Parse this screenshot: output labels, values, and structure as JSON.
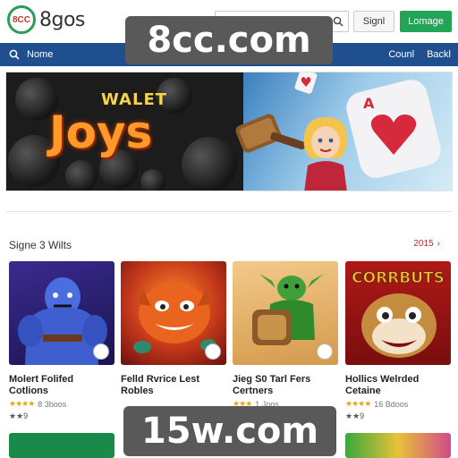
{
  "header": {
    "logo_badge": "8CC",
    "logo_text": "8gos",
    "search_placeholder": "",
    "login_label": "Signl",
    "register_label": "Lomage"
  },
  "nav": {
    "home_label": "Nome",
    "right_items": [
      "Counl",
      "Backl"
    ]
  },
  "watermarks": {
    "top": "8cc.com",
    "bottom": "15w.com"
  },
  "hero": {
    "small_text": "WALET",
    "big_text": "Joys"
  },
  "section": {
    "title": "Signe 3 Wilts",
    "link_label": "2015"
  },
  "games": [
    {
      "title": "Molert Folifed Cotlions",
      "rating_text": "8 3boos",
      "sub": "★★9"
    },
    {
      "title": "Felld Rvrice Lest Robles",
      "rating_text": "",
      "sub": ""
    },
    {
      "title": "Jieg S0 Tarl Fers Certners",
      "rating_text": "1 Joos",
      "sub": ""
    },
    {
      "title": "Hollics Welrded Cetaine",
      "rating_text": "16 Bdoos",
      "sub": "★★9"
    }
  ],
  "big_card_title": "CORRBUTS",
  "colors": {
    "nav_bg": "#1f4f8f",
    "accent_green": "#22a556",
    "link_red": "#b0292b"
  }
}
